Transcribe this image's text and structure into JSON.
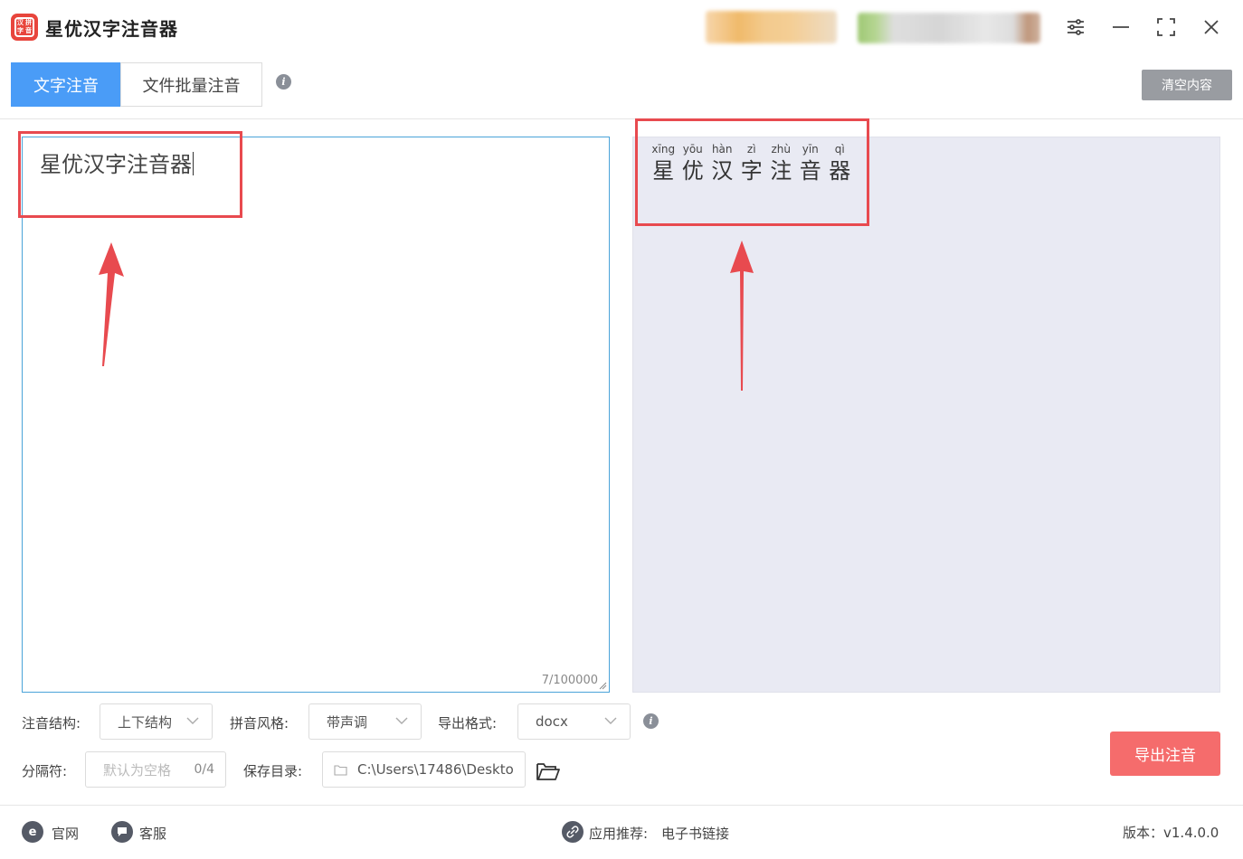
{
  "app": {
    "title": "星优汉字注音器",
    "logo_glyphs": [
      "汉",
      "拼",
      "字",
      "音"
    ]
  },
  "tabs": [
    {
      "label": "文字注音",
      "active": true
    },
    {
      "label": "文件批量注音",
      "active": false
    }
  ],
  "toolbar": {
    "clear_label": "清空内容"
  },
  "input": {
    "text": "星优汉字注音器",
    "counter": "7/100000"
  },
  "output": {
    "chars": [
      {
        "pinyin": "xīng",
        "hanzi": "星"
      },
      {
        "pinyin": "yōu",
        "hanzi": "优"
      },
      {
        "pinyin": "hàn",
        "hanzi": "汉"
      },
      {
        "pinyin": "zì",
        "hanzi": "字"
      },
      {
        "pinyin": "zhù",
        "hanzi": "注"
      },
      {
        "pinyin": "yīn",
        "hanzi": "音"
      },
      {
        "pinyin": "qì",
        "hanzi": "器"
      }
    ]
  },
  "options": {
    "structure_label": "注音结构:",
    "structure_value": "上下结构",
    "style_label": "拼音风格:",
    "style_value": "带声调",
    "format_label": "导出格式:",
    "format_value": "docx",
    "separator_label": "分隔符:",
    "separator_placeholder": "默认为空格",
    "separator_count": "0/4",
    "savedir_label": "保存目录:",
    "savedir_value": "C:\\Users\\17486\\Deskto",
    "export_label": "导出注音"
  },
  "footer": {
    "website_label": "官网",
    "service_label": "客服",
    "recommend_label": "应用推荐:",
    "recommend_link": "电子书链接",
    "version": "版本：v1.4.0.0"
  },
  "colors": {
    "accent": "#4a9cf7",
    "export": "#f56c6c",
    "annotation": "#e84a4f",
    "output_bg": "#e9eaf3"
  }
}
